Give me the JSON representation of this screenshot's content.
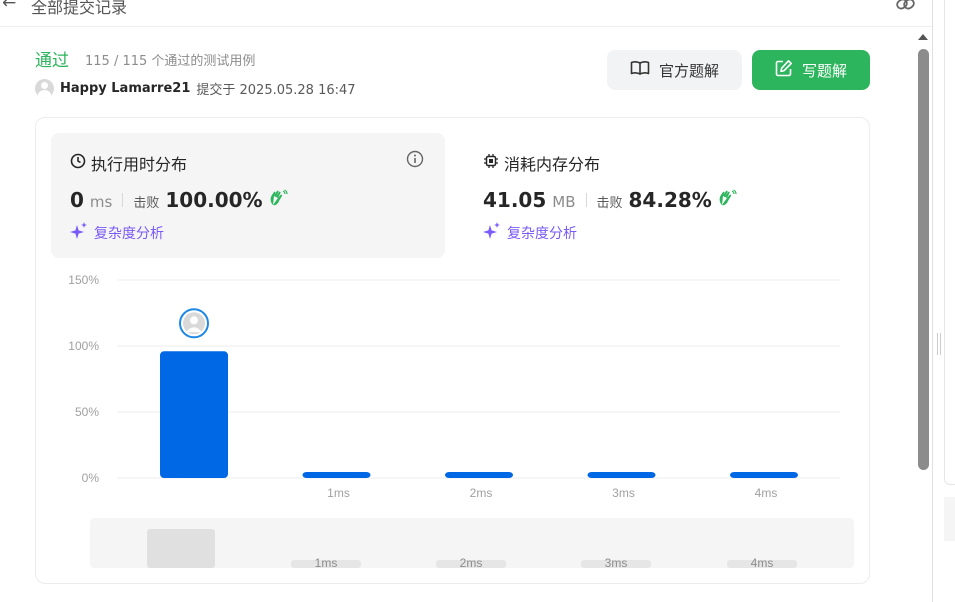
{
  "header": {
    "back_icon": "arrow-left-icon",
    "title": "全部提交记录",
    "link_icon": "link-icon"
  },
  "result": {
    "status": "通过",
    "cases": "115 / 115 个通过的测试用例",
    "username": "Happy Lamarre21",
    "submitted_at": "提交于 2025.05.28 16:47"
  },
  "buttons": {
    "official": "官方题解",
    "write": "写题解"
  },
  "runtime": {
    "title": "执行用时分布",
    "value": "0",
    "unit": "ms",
    "beat_label": "击败",
    "beat_pct": "100.00%",
    "complexity": "复杂度分析"
  },
  "memory": {
    "title": "消耗内存分布",
    "value": "41.05",
    "unit": "MB",
    "beat_label": "击败",
    "beat_pct": "84.28%",
    "complexity": "复杂度分析"
  },
  "colors": {
    "accent_green": "#2db55d",
    "bar_blue": "#0068e5",
    "ai_purple": "#7a5af8"
  },
  "chart_data": {
    "type": "bar",
    "categories": [
      "",
      "1ms",
      "2ms",
      "3ms",
      "4ms"
    ],
    "values": [
      96,
      1.5,
      1.5,
      1.5,
      1.5
    ],
    "y_ticks": [
      "0%",
      "50%",
      "100%",
      "150%"
    ],
    "ylim": [
      0,
      150
    ],
    "grid": true,
    "user_marker_category": 0,
    "brush_labels": [
      "1ms",
      "2ms",
      "3ms",
      "4ms"
    ]
  }
}
